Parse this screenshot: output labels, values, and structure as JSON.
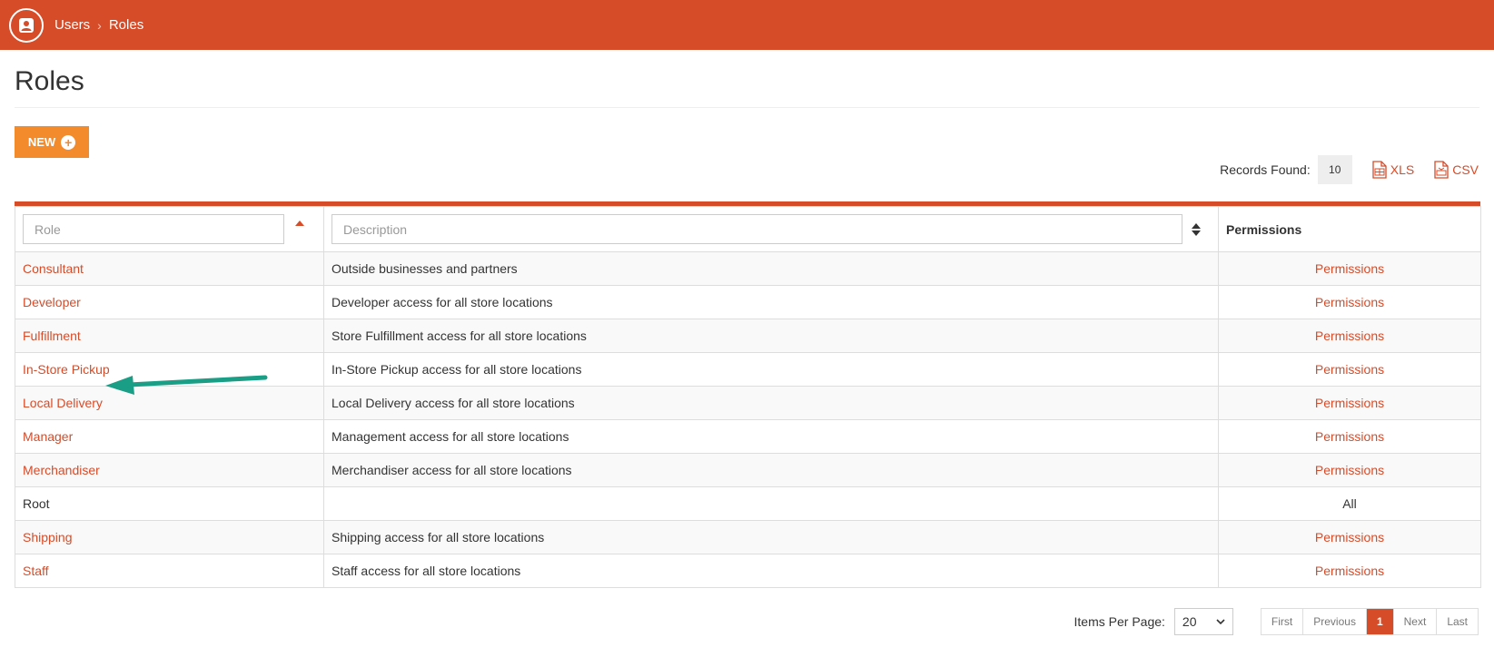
{
  "breadcrumb": {
    "items": [
      "Users",
      "Roles"
    ]
  },
  "page": {
    "title": "Roles"
  },
  "toolbar": {
    "new_label": "NEW",
    "records_label": "Records Found:",
    "records_count": "10",
    "xls_label": "XLS",
    "csv_label": "CSV"
  },
  "table": {
    "role_placeholder": "Role",
    "description_placeholder": "Description",
    "permissions_header": "Permissions",
    "rows": [
      {
        "role": "Consultant",
        "description": "Outside businesses and partners",
        "permissions": "Permissions"
      },
      {
        "role": "Developer",
        "description": "Developer access for all store locations",
        "permissions": "Permissions"
      },
      {
        "role": "Fulfillment",
        "description": "Store Fulfillment access for all store locations",
        "permissions": "Permissions"
      },
      {
        "role": "In-Store Pickup",
        "description": "In-Store Pickup access for all store locations",
        "permissions": "Permissions"
      },
      {
        "role": "Local Delivery",
        "description": "Local Delivery access for all store locations",
        "permissions": "Permissions"
      },
      {
        "role": "Manager",
        "description": "Management access for all store locations",
        "permissions": "Permissions"
      },
      {
        "role": "Merchandiser",
        "description": "Merchandiser access for all store locations",
        "permissions": "Permissions"
      },
      {
        "role": "Root",
        "description": "",
        "permissions": "All"
      },
      {
        "role": "Shipping",
        "description": "Shipping access for all store locations",
        "permissions": "Permissions"
      },
      {
        "role": "Staff",
        "description": "Staff access for all store locations",
        "permissions": "Permissions"
      }
    ]
  },
  "pagination": {
    "items_per_page_label": "Items Per Page:",
    "items_per_page_value": "20",
    "first": "First",
    "previous": "Previous",
    "current": "1",
    "next": "Next",
    "last": "Last"
  },
  "colors": {
    "brand": "#d64c29",
    "new_button": "#f38b2c",
    "annotation_arrow": "#1a9e85"
  }
}
